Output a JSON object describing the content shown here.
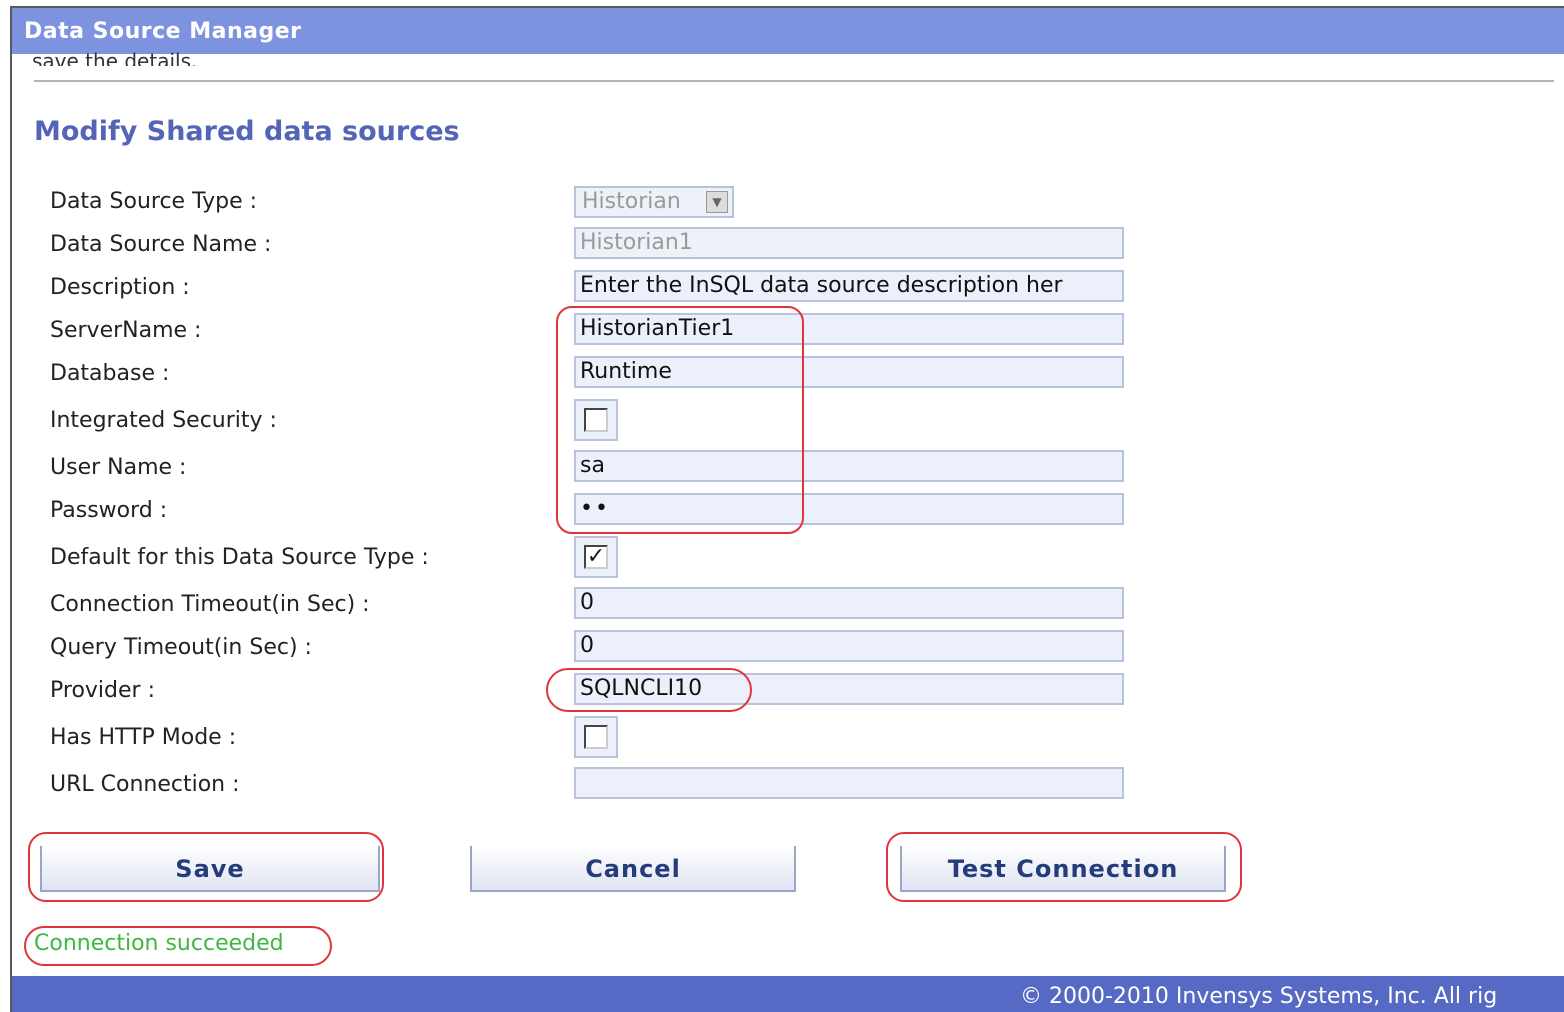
{
  "window": {
    "title": "Data Source Manager"
  },
  "intro_text_clipped": "save the details.",
  "section_title": "Modify Shared data sources",
  "fields": {
    "data_source_type": {
      "label": "Data Source Type :",
      "value": "Historian"
    },
    "data_source_name": {
      "label": "Data Source Name :",
      "value": "Historian1"
    },
    "description": {
      "label": "Description :",
      "value": "Enter the InSQL data source description her"
    },
    "server_name": {
      "label": "ServerName :",
      "value": "HistorianTier1"
    },
    "database": {
      "label": "Database :",
      "value": "Runtime"
    },
    "integrated_security": {
      "label": "Integrated Security :",
      "checked": false
    },
    "user_name": {
      "label": "User Name :",
      "value": "sa"
    },
    "password": {
      "label": "Password :",
      "value": "••"
    },
    "default_for_type": {
      "label": "Default for this Data Source Type :",
      "checked": true,
      "mark": "✓"
    },
    "connection_timeout": {
      "label": "Connection Timeout(in Sec) :",
      "value": "0"
    },
    "query_timeout": {
      "label": "Query Timeout(in Sec) :",
      "value": "0"
    },
    "provider": {
      "label": "Provider :",
      "value": "SQLNCLI10"
    },
    "has_http_mode": {
      "label": "Has HTTP Mode :",
      "checked": false
    },
    "url_connection": {
      "label": "URL Connection :",
      "value": ""
    }
  },
  "buttons": {
    "save": "Save",
    "cancel": "Cancel",
    "test_connection": "Test Connection"
  },
  "status": {
    "message": "Connection succeeded",
    "color": "#3eb83e"
  },
  "footer": {
    "copyright": "© 2000-2010 Invensys Systems, Inc. All rig"
  },
  "colors": {
    "titlebar": "#7d93df",
    "footer": "#5669c4",
    "accent_title": "#5465b8",
    "highlight": "#e0343a"
  }
}
